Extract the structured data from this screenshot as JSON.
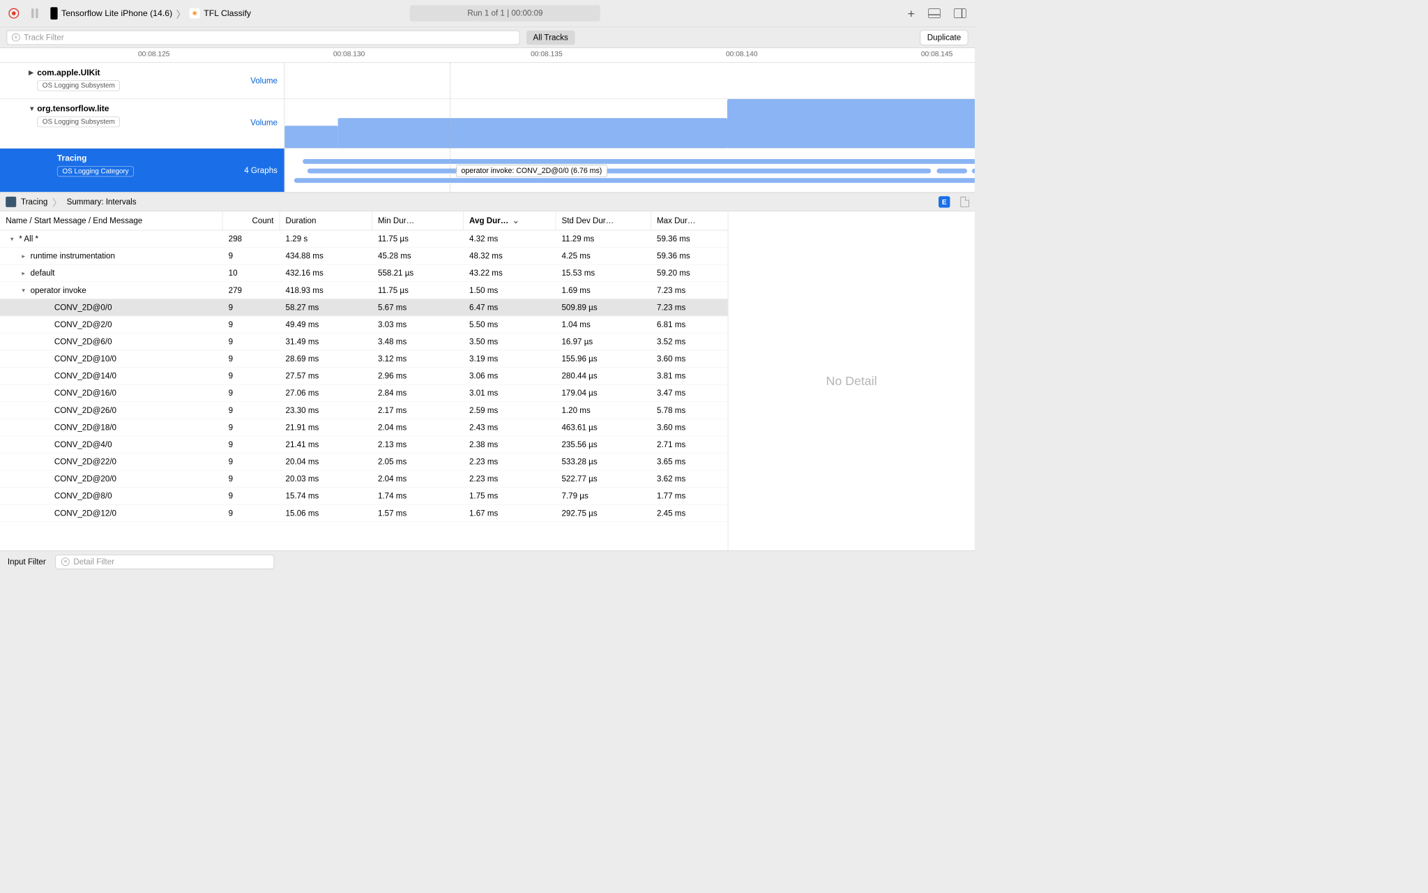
{
  "toolbar": {
    "device_label": "Tensorflow Lite iPhone (14.6)",
    "app_label": "TFL Classify",
    "run_status": "Run 1 of 1  |  00:00:09"
  },
  "filterbar": {
    "track_filter_placeholder": "Track Filter",
    "all_tracks_label": "All Tracks",
    "duplicate_label": "Duplicate"
  },
  "ruler": {
    "ticks": [
      "00:08.125",
      "00:08.130",
      "00:08.135",
      "00:08.140",
      "00:08.145"
    ]
  },
  "tracks": [
    {
      "title": "com.apple.UIKit",
      "badge": "OS Logging Subsystem",
      "metric": "Volume",
      "disclosure": "▶",
      "selected": false
    },
    {
      "title": "org.tensorflow.lite",
      "badge": "OS Logging Subsystem",
      "metric": "Volume",
      "disclosure": "▼",
      "selected": false
    },
    {
      "title": "Tracing",
      "badge": "OS Logging Category",
      "metric": "4 Graphs",
      "disclosure": "",
      "selected": true,
      "tooltip": "operator invoke: CONV_2D@0/0 (6.76 ms)"
    }
  ],
  "pathbar": {
    "item1": "Tracing",
    "item2": "Summary: Intervals"
  },
  "table": {
    "columns": {
      "name": "Name / Start Message / End Message",
      "count": "Count",
      "duration": "Duration",
      "min": "Min Dur…",
      "avg": "Avg Dur…",
      "std": "Std Dev Dur…",
      "max": "Max Dur…"
    },
    "rows": [
      {
        "indent": 0,
        "tri": "▾",
        "name": "* All *",
        "count": "298",
        "dur": "1.29 s",
        "min": "11.75 µs",
        "avg": "4.32 ms",
        "std": "11.29 ms",
        "max": "59.36 ms",
        "sel": false
      },
      {
        "indent": 1,
        "tri": "▸",
        "name": "runtime instrumentation",
        "count": "9",
        "dur": "434.88 ms",
        "min": "45.28 ms",
        "avg": "48.32 ms",
        "std": "4.25 ms",
        "max": "59.36 ms",
        "sel": false
      },
      {
        "indent": 1,
        "tri": "▸",
        "name": "default",
        "count": "10",
        "dur": "432.16 ms",
        "min": "558.21 µs",
        "avg": "43.22 ms",
        "std": "15.53 ms",
        "max": "59.20 ms",
        "sel": false
      },
      {
        "indent": 1,
        "tri": "▾",
        "name": "operator invoke",
        "count": "279",
        "dur": "418.93 ms",
        "min": "11.75 µs",
        "avg": "1.50 ms",
        "std": "1.69 ms",
        "max": "7.23 ms",
        "sel": false
      },
      {
        "indent": 3,
        "tri": "",
        "name": "CONV_2D@0/0",
        "count": "9",
        "dur": "58.27 ms",
        "min": "5.67 ms",
        "avg": "6.47 ms",
        "std": "509.89 µs",
        "max": "7.23 ms",
        "sel": true
      },
      {
        "indent": 3,
        "tri": "",
        "name": "CONV_2D@2/0",
        "count": "9",
        "dur": "49.49 ms",
        "min": "3.03 ms",
        "avg": "5.50 ms",
        "std": "1.04 ms",
        "max": "6.81 ms",
        "sel": false
      },
      {
        "indent": 3,
        "tri": "",
        "name": "CONV_2D@6/0",
        "count": "9",
        "dur": "31.49 ms",
        "min": "3.48 ms",
        "avg": "3.50 ms",
        "std": "16.97 µs",
        "max": "3.52 ms",
        "sel": false
      },
      {
        "indent": 3,
        "tri": "",
        "name": "CONV_2D@10/0",
        "count": "9",
        "dur": "28.69 ms",
        "min": "3.12 ms",
        "avg": "3.19 ms",
        "std": "155.96 µs",
        "max": "3.60 ms",
        "sel": false
      },
      {
        "indent": 3,
        "tri": "",
        "name": "CONV_2D@14/0",
        "count": "9",
        "dur": "27.57 ms",
        "min": "2.96 ms",
        "avg": "3.06 ms",
        "std": "280.44 µs",
        "max": "3.81 ms",
        "sel": false
      },
      {
        "indent": 3,
        "tri": "",
        "name": "CONV_2D@16/0",
        "count": "9",
        "dur": "27.06 ms",
        "min": "2.84 ms",
        "avg": "3.01 ms",
        "std": "179.04 µs",
        "max": "3.47 ms",
        "sel": false
      },
      {
        "indent": 3,
        "tri": "",
        "name": "CONV_2D@26/0",
        "count": "9",
        "dur": "23.30 ms",
        "min": "2.17 ms",
        "avg": "2.59 ms",
        "std": "1.20 ms",
        "max": "5.78 ms",
        "sel": false
      },
      {
        "indent": 3,
        "tri": "",
        "name": "CONV_2D@18/0",
        "count": "9",
        "dur": "21.91 ms",
        "min": "2.04 ms",
        "avg": "2.43 ms",
        "std": "463.61 µs",
        "max": "3.60 ms",
        "sel": false
      },
      {
        "indent": 3,
        "tri": "",
        "name": "CONV_2D@4/0",
        "count": "9",
        "dur": "21.41 ms",
        "min": "2.13 ms",
        "avg": "2.38 ms",
        "std": "235.56 µs",
        "max": "2.71 ms",
        "sel": false
      },
      {
        "indent": 3,
        "tri": "",
        "name": "CONV_2D@22/0",
        "count": "9",
        "dur": "20.04 ms",
        "min": "2.05 ms",
        "avg": "2.23 ms",
        "std": "533.28 µs",
        "max": "3.65 ms",
        "sel": false
      },
      {
        "indent": 3,
        "tri": "",
        "name": "CONV_2D@20/0",
        "count": "9",
        "dur": "20.03 ms",
        "min": "2.04 ms",
        "avg": "2.23 ms",
        "std": "522.77 µs",
        "max": "3.62 ms",
        "sel": false
      },
      {
        "indent": 3,
        "tri": "",
        "name": "CONV_2D@8/0",
        "count": "9",
        "dur": "15.74 ms",
        "min": "1.74 ms",
        "avg": "1.75 ms",
        "std": "7.79 µs",
        "max": "1.77 ms",
        "sel": false
      },
      {
        "indent": 3,
        "tri": "",
        "name": "CONV_2D@12/0",
        "count": "9",
        "dur": "15.06 ms",
        "min": "1.57 ms",
        "avg": "1.67 ms",
        "std": "292.75 µs",
        "max": "2.45 ms",
        "sel": false
      }
    ]
  },
  "detail_pane": {
    "empty_text": "No Detail"
  },
  "bottombar": {
    "input_filter_label": "Input Filter",
    "detail_filter_placeholder": "Detail Filter"
  }
}
